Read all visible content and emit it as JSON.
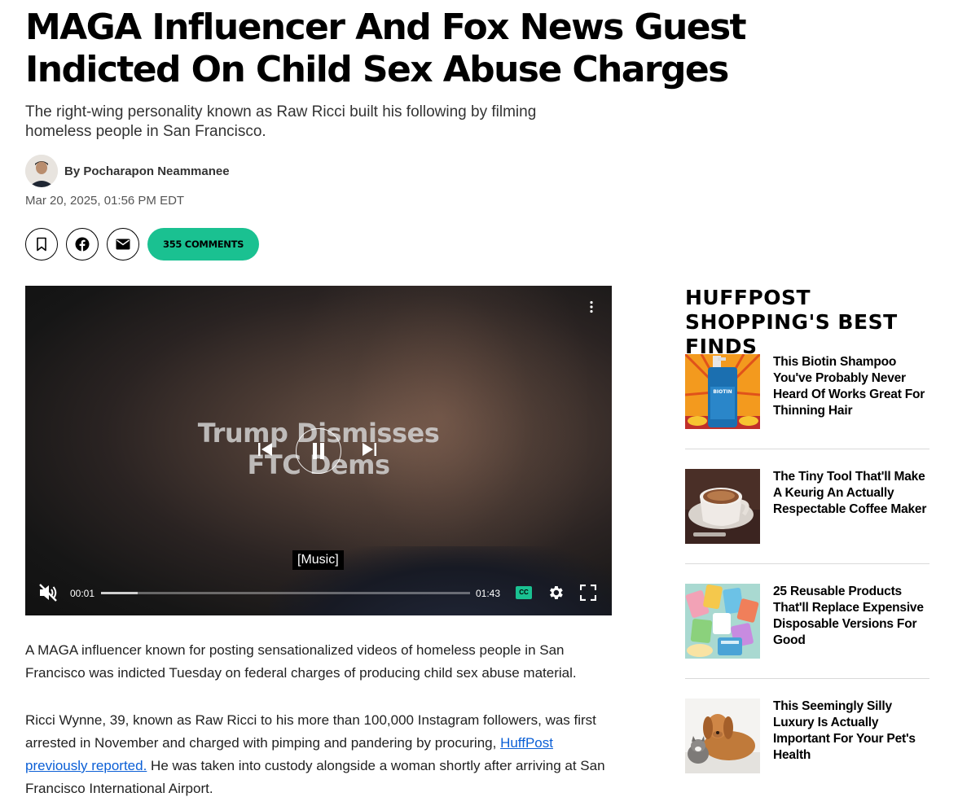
{
  "article": {
    "headline": "MAGA Influencer And Fox News Guest Indicted On Child Sex Abuse Charges",
    "dek": "The right-wing personality known as Raw Ricci built his following by filming homeless people in San Francisco.",
    "author": "By Pocharapon Neammanee",
    "date": "Mar 20, 2025, 01:56 PM EDT",
    "comments_label": "355 COMMENTS",
    "share_icons": [
      "bookmark-icon",
      "facebook-icon",
      "email-icon"
    ]
  },
  "video": {
    "title_line1": "Trump Dismisses",
    "title_line2": "FTC Dems",
    "caption": "[Music]",
    "current_time": "00:01",
    "duration": "01:43",
    "progress": 0.1,
    "cc_label": "CC"
  },
  "body": {
    "p1": "A MAGA influencer known for posting sensationalized videos of homeless people in San Francisco was indicted Tuesday on federal charges of producing child sex abuse material.",
    "p2_before": "Ricci Wynne, 39, known as Raw Ricci to his more than 100,000 Instagram followers, was first arrested in November and charged with pimping and pandering by procuring, ",
    "p2_link": "HuffPost previously reported.",
    "p2_after": " He was taken into custody alongside a woman shortly after arriving at San Francisco International Airport."
  },
  "sidebar": {
    "title": "HUFFPOST SHOPPING'S BEST FINDS",
    "items": [
      {
        "title": "This Biotin Shampoo You've Probably Never Heard Of Works Great For Thinning Hair",
        "image": "biotin-shampoo",
        "image_label": "BIOTIN"
      },
      {
        "title": "The Tiny Tool That'll Make A Keurig An Actually Respectable Coffee Maker",
        "image": "coffee-cup"
      },
      {
        "title": "25 Reusable Products That'll Replace Expensive Disposable Versions For Good",
        "image": "reusable-products"
      },
      {
        "title": "This Seemingly Silly Luxury Is Actually Important For Your Pet's Health",
        "image": "dog-and-cat"
      }
    ]
  },
  "colors": {
    "accent": "#1ac191",
    "link": "#0b5fd6"
  }
}
